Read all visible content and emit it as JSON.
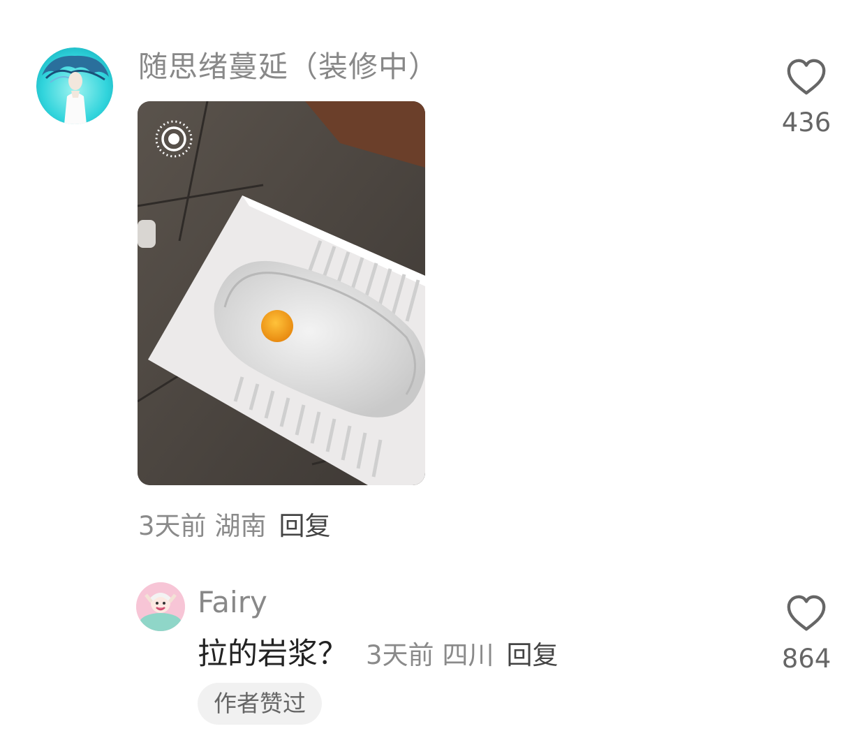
{
  "comment": {
    "username": "随思绪蔓延（装修中）",
    "avatar_icon": "avatar-girl-blue-hair-icon",
    "photo_icon": "toilet-photo-image",
    "live_icon": "live-photo-icon",
    "time": "3天前",
    "location": "湖南",
    "reply_label": "回复",
    "likes": "436"
  },
  "reply": {
    "username": "Fairy",
    "avatar_icon": "avatar-cartoon-pink-icon",
    "text": "拉的岩浆？",
    "time": "3天前",
    "location": "四川",
    "reply_label": "回复",
    "badge": "作者赞过",
    "likes": "864"
  },
  "colors": {
    "meta_gray": "#8a8a8a",
    "username_gray": "#888888",
    "badge_bg": "#f1f1f1",
    "yolk": "#f5a623"
  }
}
